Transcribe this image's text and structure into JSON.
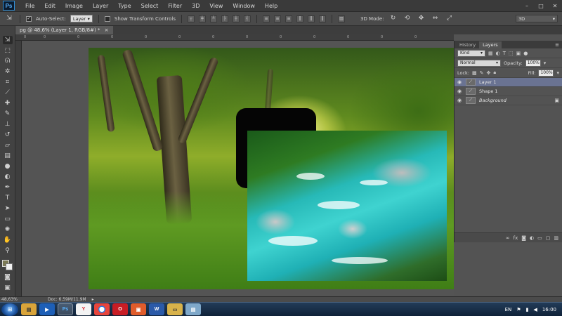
{
  "app": {
    "logo": "Ps"
  },
  "menu": [
    "File",
    "Edit",
    "Image",
    "Layer",
    "Type",
    "Select",
    "Filter",
    "3D",
    "View",
    "Window",
    "Help"
  ],
  "window_controls": [
    "–",
    "□",
    "✕"
  ],
  "options_bar": {
    "auto_select_label": "Auto-Select:",
    "auto_select_value": "Layer",
    "show_transform_label": "Show Transform Controls",
    "mode_3d_label": "3D Mode:",
    "workspace_value": "3D"
  },
  "document_tab": {
    "title": "pg @ 48,6% (Layer 1, RGB/8#) *",
    "close": "×"
  },
  "ruler_ticks": [
    "0",
    "0",
    "0",
    "0",
    "0",
    "0",
    "0",
    "0",
    "0",
    "0",
    "0",
    "0",
    "0"
  ],
  "panel": {
    "tabs": [
      "History",
      "Layers"
    ],
    "active_tab": "Layers",
    "filter_label": "Kind",
    "blend_mode": "Normal",
    "opacity_label": "Opacity:",
    "opacity_value": "100%",
    "lock_label": "Lock:",
    "fill_label": "Fill:",
    "fill_value": "100%",
    "layers": [
      {
        "name": "Layer 1",
        "selected": true,
        "italic": false,
        "locked": false
      },
      {
        "name": "Shape 1",
        "selected": false,
        "italic": false,
        "locked": false
      },
      {
        "name": "Background",
        "selected": false,
        "italic": true,
        "locked": true
      }
    ],
    "bottom_buttons": [
      "link-icon",
      "fx-icon",
      "mask-icon",
      "adjustment-icon",
      "folder-icon",
      "new-layer-icon",
      "trash-icon"
    ]
  },
  "status": {
    "zoom": "48,63%",
    "doc_info": "Doc: 6,59M/11,9M"
  },
  "taskbar": {
    "apps": [
      "explorer-icon",
      "media-icon",
      "Ps",
      "browser-y-icon",
      "chrome-icon",
      "opera-icon",
      "pdf-icon",
      "word-icon",
      "folder-icon",
      "notepad-icon"
    ],
    "language": "EN",
    "time": "16:00"
  },
  "colors": {
    "foreground": "#7c7a55",
    "background": "#f2f2f2",
    "selected_layer": "#6a7392"
  }
}
